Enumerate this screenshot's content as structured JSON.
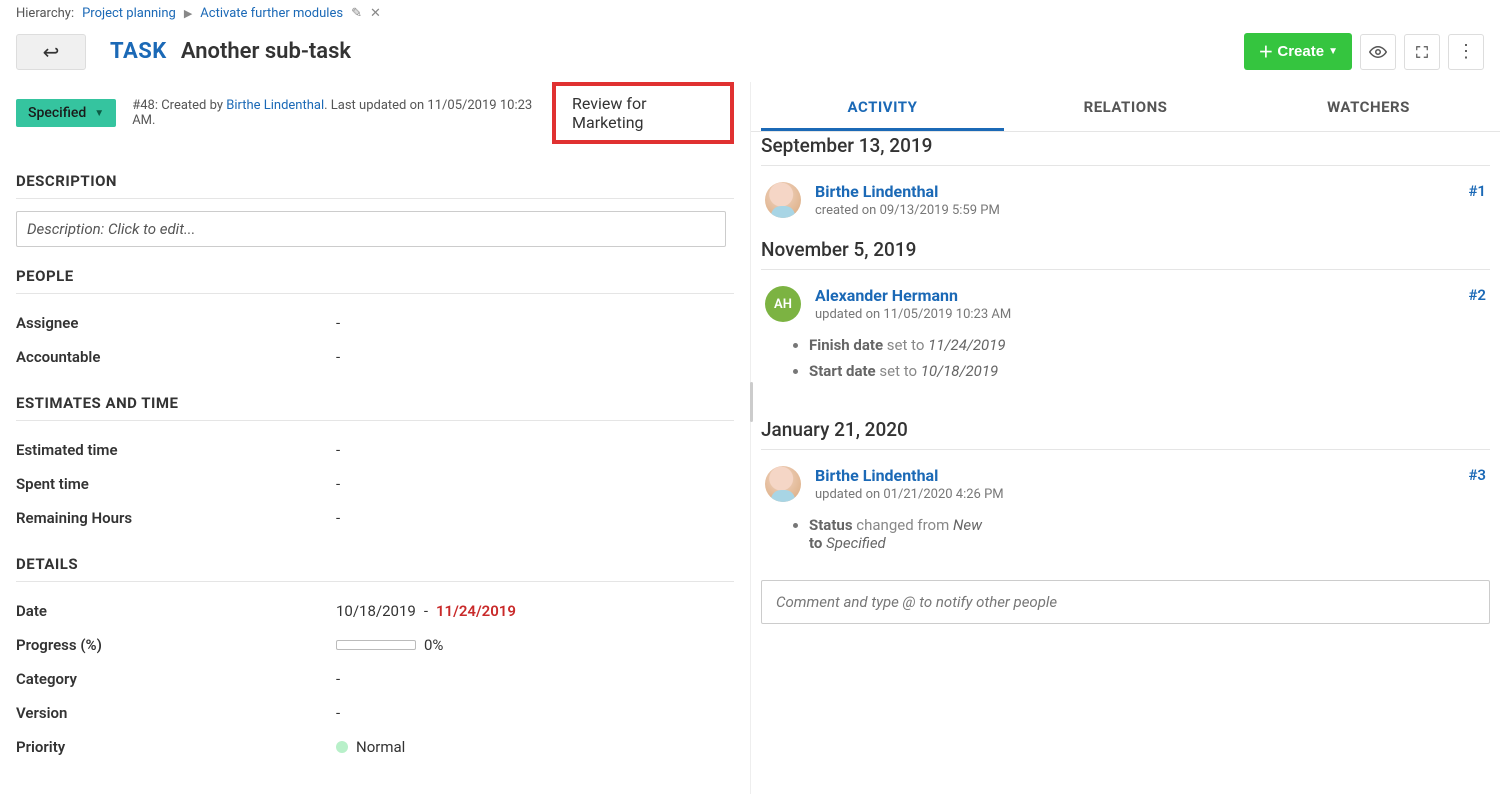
{
  "breadcrumb": {
    "label": "Hierarchy:",
    "items": [
      "Project planning",
      "Activate further modules"
    ]
  },
  "header": {
    "type": "TASK",
    "title": "Another sub-task",
    "create": "Create"
  },
  "status": {
    "value": "Specified",
    "meta_prefix": "#48: Created by ",
    "author": "Birthe Lindenthal",
    "meta_suffix": ". Last updated on 11/05/2019 10:23 AM.",
    "review": "Review for Marketing"
  },
  "sections": {
    "description": {
      "title": "DESCRIPTION",
      "placeholder": "Description: Click to edit..."
    },
    "people": {
      "title": "PEOPLE",
      "fields": [
        {
          "label": "Assignee",
          "value": "-"
        },
        {
          "label": "Accountable",
          "value": "-"
        }
      ]
    },
    "estimates": {
      "title": "ESTIMATES AND TIME",
      "fields": [
        {
          "label": "Estimated time",
          "value": "-"
        },
        {
          "label": "Spent time",
          "value": "-"
        },
        {
          "label": "Remaining Hours",
          "value": "-"
        }
      ]
    },
    "details": {
      "title": "DETAILS",
      "date": {
        "label": "Date",
        "start": "10/18/2019",
        "sep": " - ",
        "end": "11/24/2019"
      },
      "progress": {
        "label": "Progress (%)",
        "value": "0%"
      },
      "category": {
        "label": "Category",
        "value": "-"
      },
      "version": {
        "label": "Version",
        "value": "-"
      },
      "priority": {
        "label": "Priority",
        "value": "Normal"
      }
    }
  },
  "tabs": [
    "ACTIVITY",
    "RELATIONS",
    "WATCHERS"
  ],
  "activity": {
    "groups": [
      {
        "date": "September 13, 2019",
        "entries": [
          {
            "author": "Birthe Lindenthal",
            "avatar": "photo",
            "meta": "created on 09/13/2019 5:59 PM",
            "num": "#1",
            "changes": []
          }
        ]
      },
      {
        "date": "November 5, 2019",
        "entries": [
          {
            "author": "Alexander Hermann",
            "avatar": "AH",
            "meta": "updated on 11/05/2019 10:23 AM",
            "num": "#2",
            "changes": [
              {
                "field": "Finish date",
                "verb": "set to",
                "val": "11/24/2019"
              },
              {
                "field": "Start date",
                "verb": "set to",
                "val": "10/18/2019"
              }
            ]
          }
        ]
      },
      {
        "date": "January 21, 2020",
        "entries": [
          {
            "author": "Birthe Lindenthal",
            "avatar": "photo",
            "meta": "updated on 01/21/2020 4:26 PM",
            "num": "#3",
            "changes": [
              {
                "field": "Status",
                "verb": "changed from",
                "val": "New",
                "verb2": "to",
                "val2": "Specified"
              }
            ]
          }
        ]
      }
    ],
    "comment_placeholder": "Comment and type @ to notify other people"
  }
}
